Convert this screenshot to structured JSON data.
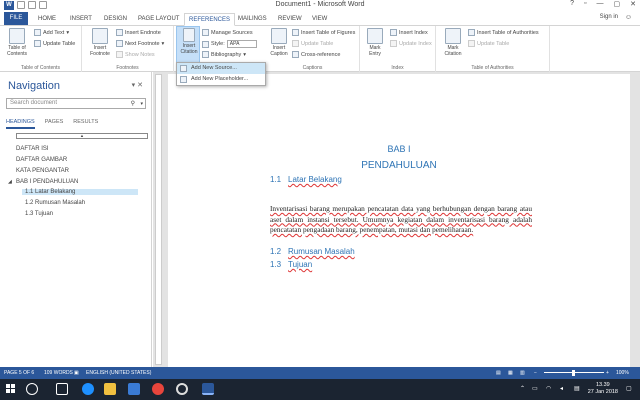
{
  "window": {
    "title": "Document1 - Microsoft Word",
    "controls": [
      "?",
      "▫",
      "—",
      "▢",
      "✕"
    ]
  },
  "tabs": [
    "FILE",
    "HOME",
    "INSERT",
    "DESIGN",
    "PAGE LAYOUT",
    "REFERENCES",
    "MAILINGS",
    "REVIEW",
    "VIEW"
  ],
  "active_tab": "REFERENCES",
  "signin": "Sign in",
  "ribbon": {
    "toc": {
      "label": "Table of Contents",
      "add_text": "Add Text",
      "update_table": "Update Table",
      "group": "Table of Contents"
    },
    "footnotes": {
      "insert_footnote": "Insert Footnote",
      "insert_endnote": "Insert Endnote",
      "next_footnote": "Next Footnote",
      "show_notes": "Show Notes",
      "group": "Footnotes"
    },
    "citations": {
      "insert_citation": "Insert Citation",
      "manage_sources": "Manage Sources",
      "style_label": "Style:",
      "style_value": "APA",
      "bibliography": "Bibliography",
      "group": "Citations & Bibliography"
    },
    "captions": {
      "insert_caption": "Insert Caption",
      "insert_table_of_figures": "Insert Table of Figures",
      "update_table": "Update Table",
      "cross_reference": "Cross-reference",
      "group": "Captions"
    },
    "index": {
      "mark_entry": "Mark Entry",
      "insert_index": "Insert Index",
      "update_index": "Update Index",
      "group": "Index"
    },
    "authorities": {
      "mark_citation": "Mark Citation",
      "insert_table": "Insert Table of Authorities",
      "update_table": "Update Table",
      "group": "Table of Authorities"
    }
  },
  "dropdown": [
    "Add New Source...",
    "Add New Placeholder..."
  ],
  "navigation": {
    "title": "Navigation",
    "search_placeholder": "Search document",
    "tabs": [
      "HEADINGS",
      "PAGES",
      "RESULTS"
    ],
    "headings": [
      "DAFTAR ISI",
      "DAFTAR GAMBAR",
      "KATA PENGANTAR",
      "BAB I PENDAHULUAN",
      "1.1 Latar Belakang",
      "1.2 Rumusan Masalah",
      "1.3 Tujuan"
    ]
  },
  "document": {
    "chapter": "BAB I",
    "chapter_title": "PENDAHULUAN",
    "sections": [
      {
        "num": "1.1",
        "title": "Latar Belakang"
      },
      {
        "num": "1.2",
        "title": "Rumusan Masalah"
      },
      {
        "num": "1.3",
        "title": "Tujuan"
      }
    ],
    "paragraph": "Inventarisasi barang merupakan pencatatan data yang berhubungan dengan barang atau aset dalam instansi tersebut. Umumnya kegiatan dalam inventarisasi barang adalah pencatatan pengadaan barang, penempatan, mutasi dan pemeliharaan."
  },
  "status": {
    "page": "PAGE 5 OF 6",
    "words": "109 WORDS",
    "language": "ENGLISH (UNITED STATES)",
    "zoom": "100%"
  },
  "taskbar": {
    "time": "13.39",
    "date": "27 Jan 2018"
  }
}
